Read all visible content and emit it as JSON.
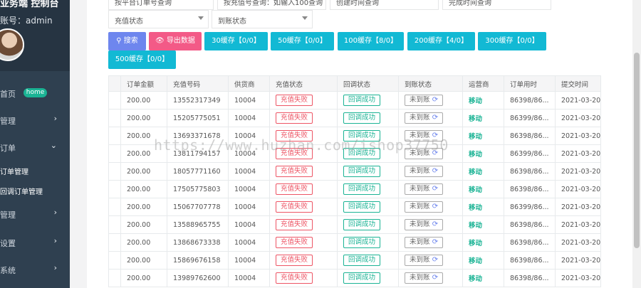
{
  "sidebar": {
    "brand": "业务端 控制台",
    "account": "账号：admin",
    "home_badge": "home",
    "items": [
      {
        "label": "首页",
        "chevron": ""
      },
      {
        "label": "管理",
        "chevron": "›"
      },
      {
        "label": "订单",
        "chevron": "⌄"
      },
      {
        "label": "管理",
        "chevron": "›"
      },
      {
        "label": "设置",
        "chevron": "›"
      },
      {
        "label": "系统",
        "chevron": "›"
      }
    ],
    "sub_items": [
      "订单管理",
      "回调订单管理"
    ]
  },
  "filters": {
    "order_no_placeholder": "按平台订单号查询",
    "recharge_no_placeholder": "按充值号查询：如输入100查询",
    "create_time_placeholder": "创建时间查询",
    "finish_time_placeholder": "完成时间查询",
    "recharge_status": "充值状态",
    "arrival_status": "到账状态"
  },
  "buttons": {
    "search": "搜索",
    "export": "导出数据",
    "cache": [
      "30缓存【0/0】",
      "50缓存【0/0】",
      "100缓存【8/0】",
      "200缓存【4/0】",
      "300缓存【0/0】",
      "500缓存【0/0】"
    ]
  },
  "table": {
    "headers": [
      "订单金额",
      "充值号码",
      "供货商",
      "充值状态",
      "回调状态",
      "到账状态",
      "运营商",
      "订单用时",
      "提交时间"
    ],
    "rows": [
      {
        "amount": "200.00",
        "phone": "13552317349",
        "supplier": "10004",
        "status": "充值失败",
        "callback": "回调成功",
        "arrival": "未到账",
        "op": "移动",
        "time": "86398/86...",
        "submitted": "2021-03-20"
      },
      {
        "amount": "200.00",
        "phone": "15205775051",
        "supplier": "10004",
        "status": "充值失败",
        "callback": "回调成功",
        "arrival": "未到账",
        "op": "移动",
        "time": "86399/86...",
        "submitted": "2021-03-20"
      },
      {
        "amount": "200.00",
        "phone": "13693371678",
        "supplier": "10004",
        "status": "充值失败",
        "callback": "回调成功",
        "arrival": "未到账",
        "op": "移动",
        "time": "86398/86...",
        "submitted": "2021-03-20"
      },
      {
        "amount": "200.00",
        "phone": "13811794157",
        "supplier": "10004",
        "status": "充值失败",
        "callback": "回调成功",
        "arrival": "未到账",
        "op": "移动",
        "time": "86399/86...",
        "submitted": "2021-03-20"
      },
      {
        "amount": "200.00",
        "phone": "18057771160",
        "supplier": "10004",
        "status": "充值失败",
        "callback": "回调成功",
        "arrival": "未到账",
        "op": "移动",
        "time": "86398/86...",
        "submitted": "2021-03-20"
      },
      {
        "amount": "200.00",
        "phone": "17505775803",
        "supplier": "10004",
        "status": "充值失败",
        "callback": "回调成功",
        "arrival": "未到账",
        "op": "移动",
        "time": "86398/86...",
        "submitted": "2021-03-20"
      },
      {
        "amount": "200.00",
        "phone": "15067707778",
        "supplier": "10004",
        "status": "充值失败",
        "callback": "回调成功",
        "arrival": "未到账",
        "op": "移动",
        "time": "86399/86...",
        "submitted": "2021-03-20"
      },
      {
        "amount": "200.00",
        "phone": "13588965755",
        "supplier": "10004",
        "status": "充值失败",
        "callback": "回调成功",
        "arrival": "未到账",
        "op": "移动",
        "time": "86398/86...",
        "submitted": "2021-03-20"
      },
      {
        "amount": "200.00",
        "phone": "13868673338",
        "supplier": "10004",
        "status": "充值失败",
        "callback": "回调成功",
        "arrival": "未到账",
        "op": "移动",
        "time": "86398/86...",
        "submitted": "2021-03-20"
      },
      {
        "amount": "200.00",
        "phone": "15869676158",
        "supplier": "10004",
        "status": "充值失败",
        "callback": "回调成功",
        "arrival": "未到账",
        "op": "移动",
        "time": "86398/86...",
        "submitted": "2021-03-20"
      },
      {
        "amount": "200.00",
        "phone": "13989762600",
        "supplier": "10004",
        "status": "充值失败",
        "callback": "回调成功",
        "arrival": "未到账",
        "op": "移动",
        "time": "86398/86...",
        "submitted": "2021-03-20"
      }
    ]
  },
  "watermark": "https://www.huzhan.com/ishop37750",
  "colors": {
    "sidebar": "#2f4050",
    "accent_green": "#1ab394",
    "fail_red": "#ed5565",
    "cache_button": "#12b9d4",
    "search_button": "#6e86ee",
    "export_button": "#f35a87"
  },
  "icons": {
    "search": "search-icon",
    "export": "eye-icon",
    "refresh": "refresh-icon"
  }
}
